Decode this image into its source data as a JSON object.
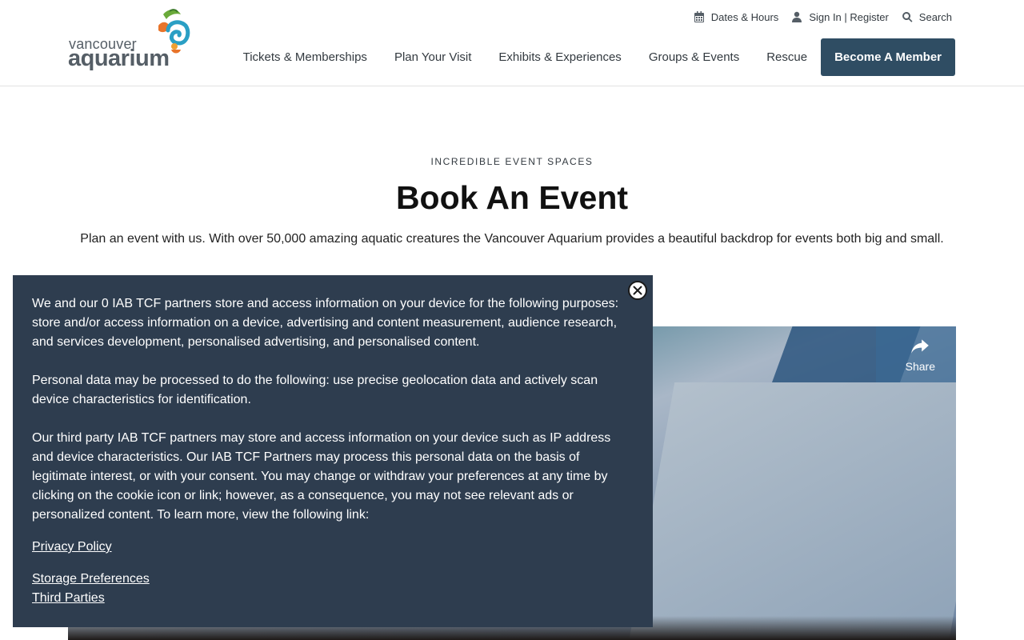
{
  "logo": {
    "line1": "vancouver",
    "line2": "aquarium"
  },
  "utility": {
    "dates_hours": "Dates & Hours",
    "sign_in": "Sign In | Register",
    "search": "Search"
  },
  "nav": {
    "items": [
      "Tickets & Memberships",
      "Plan Your Visit",
      "Exhibits & Experiences",
      "Groups & Events",
      "Rescue"
    ],
    "cta": "Become A Member"
  },
  "hero": {
    "eyebrow": "INCREDIBLE EVENT SPACES",
    "title": "Book An Event",
    "intro": "Plan an event with us. With over 50,000 amazing aquatic creatures the Vancouver Aquarium provides a beautiful backdrop for events both big and small."
  },
  "video": {
    "share_label": "Share"
  },
  "consent": {
    "paragraph1": "We and our 0 IAB TCF partners store and access information on your device for the following purposes: store and/or access information on a device, advertising and content measurement, audience research, and services development, personalised advertising, and personalised content.",
    "paragraph2": "Personal data may be processed to do the following: use precise geolocation data and actively scan device characteristics for identification.",
    "paragraph3": "Our third party IAB TCF partners may store and access information on your device such as IP address and device characteristics. Our IAB TCF Partners may process this personal data on the basis of legitimate interest, or with your consent. You may change or withdraw your preferences at any time by clicking on the cookie icon or link; however, as a consequence, you may not see relevant ads or personalized content. To learn more, view the following link:",
    "link_privacy": "Privacy Policy",
    "link_storage": "Storage Preferences",
    "link_third_parties": "Third Parties"
  },
  "colors": {
    "brand_navy": "#2f4d63",
    "consent_bg": "#2e3d4f",
    "logo_gray": "#555e66"
  }
}
